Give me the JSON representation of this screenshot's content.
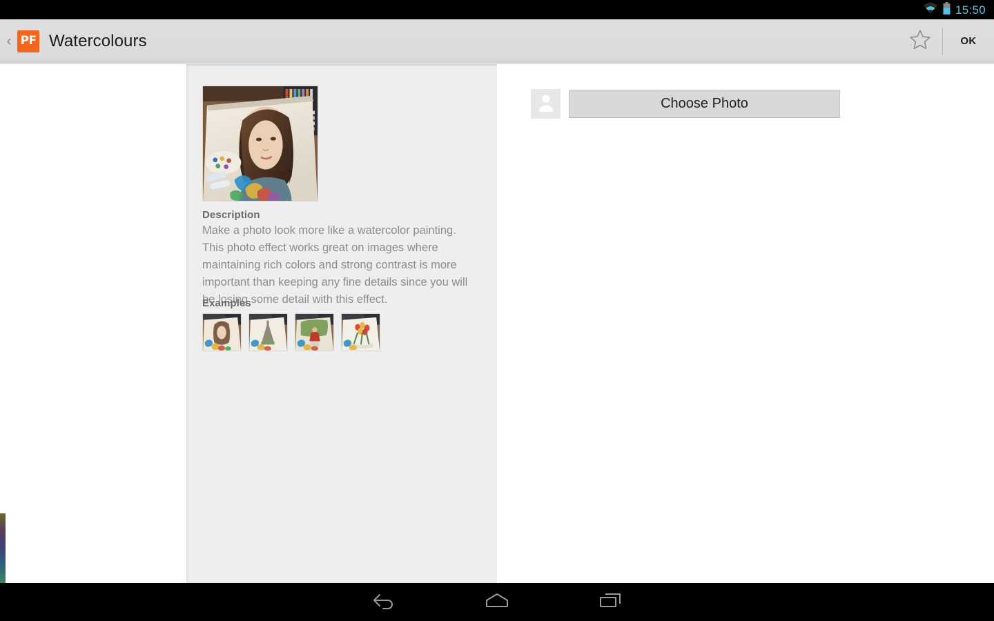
{
  "status_bar": {
    "clock": "15:50",
    "icons": [
      "wifi-icon",
      "battery-icon"
    ],
    "clock_color": "#4fc3e8",
    "background": "#000000"
  },
  "action_bar": {
    "back_chevron": "‹",
    "logo_text": "PF",
    "logo_color": "#f4661e",
    "title": "Watercolours",
    "favorite_icon": "star-outline-icon",
    "ok_label": "OK",
    "background": "#dcdcdc"
  },
  "center_panel": {
    "hero_image_alt": "watercolour-portrait-preview",
    "description_heading": "Description",
    "description_text": "Make a photo look more like a watercolor painting. This photo effect works great on images where maintaining rich colors and strong contrast is more important than keeping any fine details since you will be losing some detail with this effect.",
    "examples_heading": "Examples",
    "examples": [
      {
        "alt": "example-woman-portrait"
      },
      {
        "alt": "example-eiffel-tower"
      },
      {
        "alt": "example-man-in-garden"
      },
      {
        "alt": "example-tulip-bouquet"
      }
    ],
    "background": "#eeeeee"
  },
  "right_panel": {
    "avatar_icon": "person-placeholder-icon",
    "choose_photo_label": "Choose Photo",
    "background": "#ffffff"
  },
  "nav_bar": {
    "back_label": "back-icon",
    "home_label": "home-icon",
    "recents_label": "recent-apps-icon",
    "background": "#000000"
  }
}
